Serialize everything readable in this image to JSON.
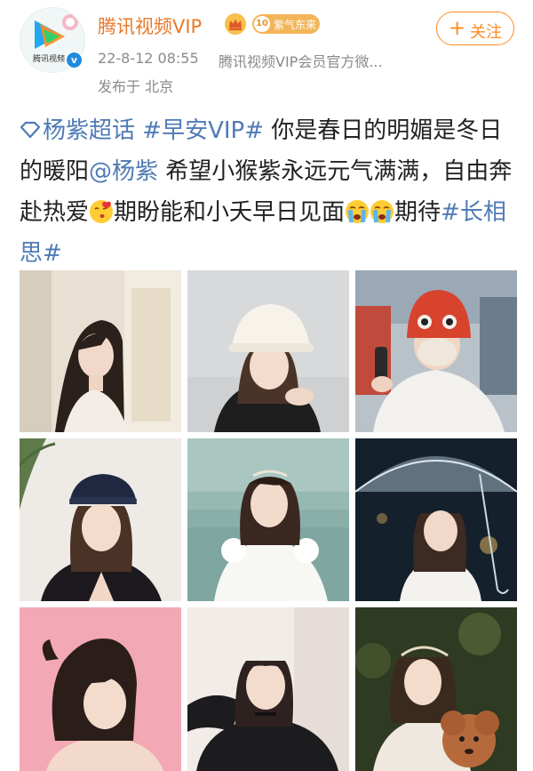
{
  "account": {
    "name": "腾讯视频VIP",
    "avatar_caption": "腾讯视频",
    "verified_mark": "v",
    "level": "10",
    "level_text": "紫气东来"
  },
  "follow_button": {
    "plus": "+",
    "label": "关注"
  },
  "post_meta": {
    "timestamp": "22-8-12 08:55",
    "source": "腾讯视频VIP会员官方微...",
    "location": "发布于 北京"
  },
  "post": {
    "topic": "杨紫超话",
    "hashtag1": "#早安VIP#",
    "text1": "你是春日的明媚是冬日的暖阳",
    "mention": "@杨紫",
    "text2": "希望小猴紫永远元气满满，自由奔赴热爱",
    "text3": "期盼能和小夭早日见面",
    "text4": "期待",
    "hashtag2": "#长相思#"
  },
  "colors": {
    "name_orange": "#e8792b",
    "follow_orange": "#ff8a1f",
    "link_blue": "#4f7bb5",
    "meta_gray": "#8a8a8a",
    "badge_gold": "#f2b55a"
  },
  "icons": [
    "tencent-video-logo-icon",
    "verified-icon",
    "crown-icon",
    "plus-icon",
    "super-topic-diamond-icon",
    "kiss-emoji-icon",
    "cry-emoji-icon"
  ],
  "photos": [
    {
      "scene": "long-hair-indoor"
    },
    {
      "scene": "white-bucket-hat"
    },
    {
      "scene": "red-knit-hat-mask"
    },
    {
      "scene": "black-beret-velvet"
    },
    {
      "scene": "white-dress-garden"
    },
    {
      "scene": "clear-umbrella-rain"
    },
    {
      "scene": "pink-background-ponytail"
    },
    {
      "scene": "black-top-choker"
    },
    {
      "scene": "holding-poodle"
    }
  ]
}
